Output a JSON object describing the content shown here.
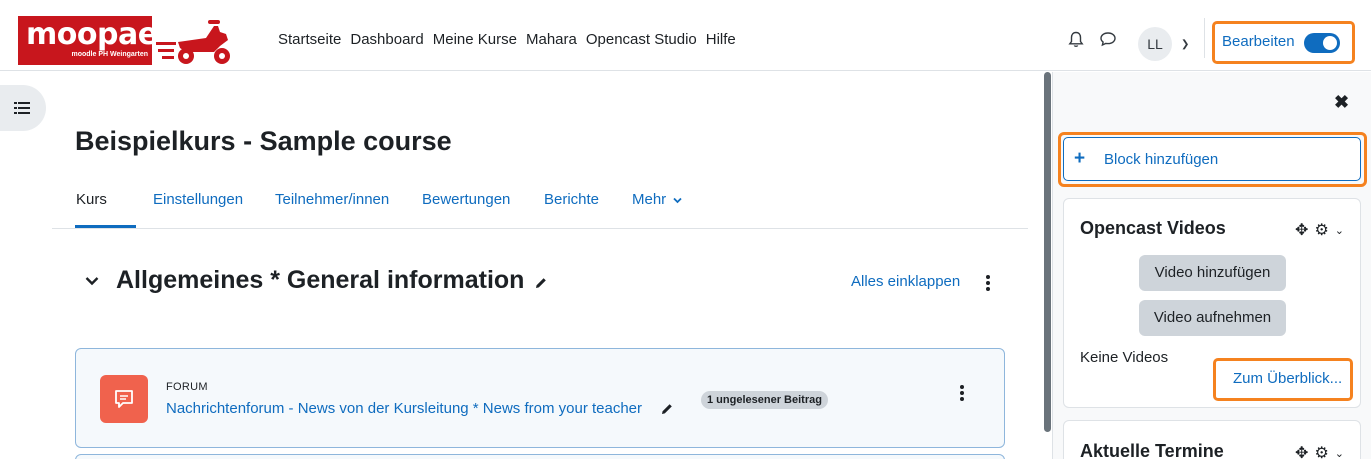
{
  "brand": {
    "logo_text": "moopaed",
    "logo_subtext": "moodle PH Weingarten"
  },
  "primary_nav": [
    "Startseite",
    "Dashboard",
    "Meine Kurse",
    "Mahara",
    "Opencast Studio",
    "Hilfe"
  ],
  "user_menu": {
    "initials": "LL",
    "edit_mode_label": "Bearbeiten",
    "edit_mode_on": true
  },
  "course": {
    "title": "Beispielkurs - Sample course",
    "tabs": [
      "Kurs",
      "Einstellungen",
      "Teilnehmer/innen",
      "Bewertungen",
      "Berichte",
      "Mehr"
    ],
    "active_tab": "Kurs"
  },
  "section": {
    "title": "Allgemeines * General information",
    "collapse_all": "Alles einklappen"
  },
  "activity": {
    "type": "FORUM",
    "name": "Nachrichtenforum - News von der Kursleitung * News from your teacher",
    "badge": "1 ungelesener Beitrag"
  },
  "drawer": {
    "add_block": "Block hinzufügen",
    "blocks": [
      {
        "title": "Opencast Videos",
        "buttons": [
          "Video hinzufügen",
          "Video aufnehmen"
        ],
        "empty_text": "Keine Videos",
        "link": "Zum Überblick..."
      },
      {
        "title": "Aktuelle Termine"
      }
    ]
  },
  "colors": {
    "accent": "#0f6cbf",
    "highlight": "#f5821f",
    "brand_red": "#c8161d",
    "forum_icon": "#f0624d"
  }
}
